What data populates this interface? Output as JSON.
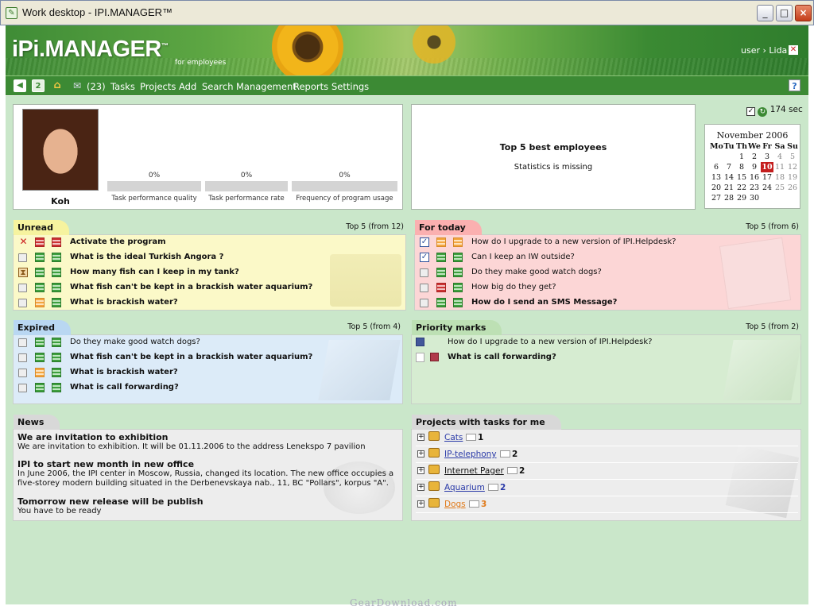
{
  "window": {
    "title": "Work desktop - IPI.MANAGER™",
    "min": "_",
    "max": "□",
    "close": "×"
  },
  "header": {
    "logo": "iPi.MANAGER",
    "logo_tm": "™",
    "subtitle": "for employees",
    "user": "user › Lida"
  },
  "menu": {
    "count": "(23)",
    "items": [
      "Tasks",
      "Projects",
      "Add",
      "Search",
      "Management",
      "Reports",
      "Settings"
    ],
    "help": "?"
  },
  "profile": {
    "name": "Koh",
    "metrics": [
      {
        "pct": "0%",
        "label": "Task performance quality",
        "value": 0
      },
      {
        "pct": "0%",
        "label": "Task performance rate",
        "value": 0
      },
      {
        "pct": "0%",
        "label": "Frequency of program usage",
        "value": 0
      }
    ]
  },
  "top5": {
    "title": "Top 5 best employees",
    "subtitle": "Statistics is missing"
  },
  "timer": {
    "text": "174 sec"
  },
  "calendar": {
    "month": "November 2006",
    "headers": [
      "Mo",
      "Tu",
      "Th",
      "We",
      "Fr",
      "Sa",
      "Su"
    ],
    "weeks": [
      [
        "",
        "",
        "1",
        "2",
        "3",
        "4",
        "5"
      ],
      [
        "6",
        "7",
        "8",
        "9",
        "10",
        "11",
        "12"
      ],
      [
        "13",
        "14",
        "15",
        "16",
        "17",
        "18",
        "19"
      ],
      [
        "20",
        "21",
        "22",
        "23",
        "24",
        "25",
        "26"
      ],
      [
        "27",
        "28",
        "29",
        "30",
        "",
        "",
        ""
      ]
    ],
    "today": "10"
  },
  "unread": {
    "title": "Unread",
    "count": "Top 5 (from 12)",
    "rows": [
      {
        "icons": [
          "x",
          "r",
          "r"
        ],
        "text": "Activate the program"
      },
      {
        "icons": [
          "box",
          "g",
          "g"
        ],
        "text": "What is the ideal Turkish Angora ?"
      },
      {
        "icons": [
          "hg",
          "g",
          "g"
        ],
        "text": "How many fish can I keep in my tank?"
      },
      {
        "icons": [
          "box",
          "g",
          "g"
        ],
        "text": "What fish can't be kept in a brackish water aquarium?"
      },
      {
        "icons": [
          "box",
          "o",
          "g"
        ],
        "text": "What is brackish water?"
      }
    ]
  },
  "today": {
    "title": "For today",
    "count": "Top 5 (from 6)",
    "rows": [
      {
        "icons": [
          "ck",
          "o",
          "o"
        ],
        "text": "How do I upgrade to a new version of IPI.Helpdesk?",
        "bold": false
      },
      {
        "icons": [
          "ck",
          "g",
          "g"
        ],
        "text": "Can I keep an IW outside?",
        "bold": false
      },
      {
        "icons": [
          "box",
          "g",
          "g"
        ],
        "text": "Do they make good watch dogs?",
        "bold": false
      },
      {
        "icons": [
          "box",
          "r",
          "g"
        ],
        "text": "How big do they get?",
        "bold": false
      },
      {
        "icons": [
          "box",
          "g",
          "g"
        ],
        "text": "How do I send an SMS Message?",
        "bold": true
      }
    ]
  },
  "expired": {
    "title": "Expired",
    "count": "Top 5 (from 4)",
    "rows": [
      {
        "icons": [
          "box",
          "g",
          "g"
        ],
        "text": "Do they make good watch dogs?",
        "bold": false
      },
      {
        "icons": [
          "box",
          "g",
          "g"
        ],
        "text": "What fish can't be kept in a brackish water aquarium?",
        "bold": true
      },
      {
        "icons": [
          "box",
          "o",
          "g"
        ],
        "text": "What is brackish water?",
        "bold": true
      },
      {
        "icons": [
          "box",
          "g",
          "g"
        ],
        "text": "What is call forwarding?",
        "bold": true
      }
    ]
  },
  "priority": {
    "title": "Priority marks",
    "count": "Top 5 (from 2)",
    "rows": [
      {
        "icons": [
          "flag"
        ],
        "text": "How do I upgrade to a new version of IPI.Helpdesk?",
        "bold": false
      },
      {
        "icons": [
          "doc",
          "flagr"
        ],
        "text": "What is call forwarding?",
        "bold": true
      }
    ]
  },
  "news": {
    "title": "News",
    "items": [
      {
        "h": "We are invitation to exhibition",
        "b": "We are invitation to exhibition. It will be 01.11.2006 to the address Lenekspo 7 pavilion"
      },
      {
        "h": "IPI to start new month in new office",
        "b": "In June 2006, the IPI center in Moscow, Russia, changed its location. The new office occupies a five-storey modern building situated in the Derbenevskaya nab., 11, BC \"Pollars\", korpus \"A\"."
      },
      {
        "h": "Tomorrow new release will be publish",
        "b": "You have to be ready"
      }
    ]
  },
  "projects": {
    "title": "Projects with tasks for me",
    "items": [
      {
        "name": "Cats",
        "count": "1",
        "color": "#2a3aa8",
        "cnt_color": "#111"
      },
      {
        "name": "IP-telephony",
        "count": "2",
        "color": "#2a3aa8",
        "cnt_color": "#111"
      },
      {
        "name": "Internet Pager",
        "count": "2",
        "color": "#111",
        "cnt_color": "#111"
      },
      {
        "name": "Aquarium",
        "count": "2",
        "color": "#2a3aa8",
        "cnt_color": "#2a3aa8"
      },
      {
        "name": "Dogs",
        "count": "3",
        "color": "#e07a1a",
        "cnt_color": "#e07a1a"
      }
    ]
  },
  "watermark": "GearDownload.com"
}
